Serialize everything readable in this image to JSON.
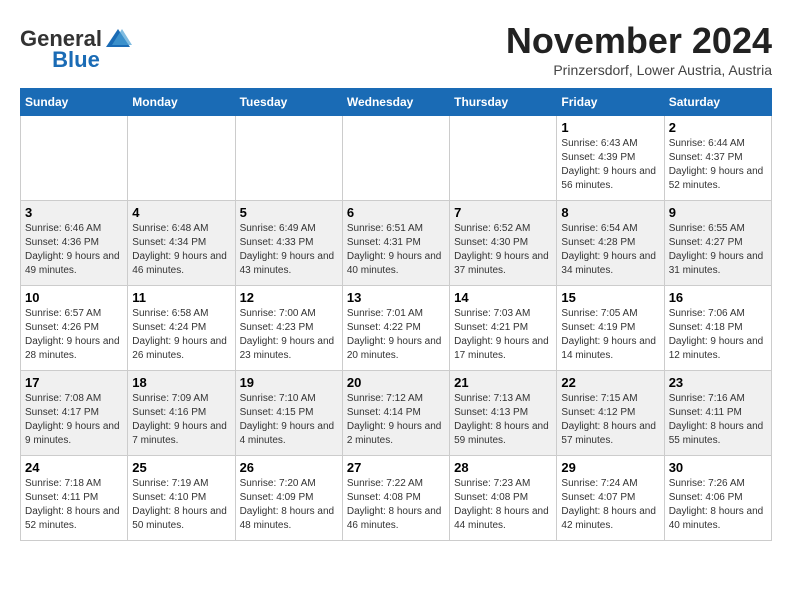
{
  "header": {
    "logo_general": "General",
    "logo_blue": "Blue",
    "month_title": "November 2024",
    "location": "Prinzersdorf, Lower Austria, Austria"
  },
  "days_of_week": [
    "Sunday",
    "Monday",
    "Tuesday",
    "Wednesday",
    "Thursday",
    "Friday",
    "Saturday"
  ],
  "weeks": [
    [
      {
        "day": "",
        "info": ""
      },
      {
        "day": "",
        "info": ""
      },
      {
        "day": "",
        "info": ""
      },
      {
        "day": "",
        "info": ""
      },
      {
        "day": "",
        "info": ""
      },
      {
        "day": "1",
        "info": "Sunrise: 6:43 AM\nSunset: 4:39 PM\nDaylight: 9 hours and 56 minutes."
      },
      {
        "day": "2",
        "info": "Sunrise: 6:44 AM\nSunset: 4:37 PM\nDaylight: 9 hours and 52 minutes."
      }
    ],
    [
      {
        "day": "3",
        "info": "Sunrise: 6:46 AM\nSunset: 4:36 PM\nDaylight: 9 hours and 49 minutes."
      },
      {
        "day": "4",
        "info": "Sunrise: 6:48 AM\nSunset: 4:34 PM\nDaylight: 9 hours and 46 minutes."
      },
      {
        "day": "5",
        "info": "Sunrise: 6:49 AM\nSunset: 4:33 PM\nDaylight: 9 hours and 43 minutes."
      },
      {
        "day": "6",
        "info": "Sunrise: 6:51 AM\nSunset: 4:31 PM\nDaylight: 9 hours and 40 minutes."
      },
      {
        "day": "7",
        "info": "Sunrise: 6:52 AM\nSunset: 4:30 PM\nDaylight: 9 hours and 37 minutes."
      },
      {
        "day": "8",
        "info": "Sunrise: 6:54 AM\nSunset: 4:28 PM\nDaylight: 9 hours and 34 minutes."
      },
      {
        "day": "9",
        "info": "Sunrise: 6:55 AM\nSunset: 4:27 PM\nDaylight: 9 hours and 31 minutes."
      }
    ],
    [
      {
        "day": "10",
        "info": "Sunrise: 6:57 AM\nSunset: 4:26 PM\nDaylight: 9 hours and 28 minutes."
      },
      {
        "day": "11",
        "info": "Sunrise: 6:58 AM\nSunset: 4:24 PM\nDaylight: 9 hours and 26 minutes."
      },
      {
        "day": "12",
        "info": "Sunrise: 7:00 AM\nSunset: 4:23 PM\nDaylight: 9 hours and 23 minutes."
      },
      {
        "day": "13",
        "info": "Sunrise: 7:01 AM\nSunset: 4:22 PM\nDaylight: 9 hours and 20 minutes."
      },
      {
        "day": "14",
        "info": "Sunrise: 7:03 AM\nSunset: 4:21 PM\nDaylight: 9 hours and 17 minutes."
      },
      {
        "day": "15",
        "info": "Sunrise: 7:05 AM\nSunset: 4:19 PM\nDaylight: 9 hours and 14 minutes."
      },
      {
        "day": "16",
        "info": "Sunrise: 7:06 AM\nSunset: 4:18 PM\nDaylight: 9 hours and 12 minutes."
      }
    ],
    [
      {
        "day": "17",
        "info": "Sunrise: 7:08 AM\nSunset: 4:17 PM\nDaylight: 9 hours and 9 minutes."
      },
      {
        "day": "18",
        "info": "Sunrise: 7:09 AM\nSunset: 4:16 PM\nDaylight: 9 hours and 7 minutes."
      },
      {
        "day": "19",
        "info": "Sunrise: 7:10 AM\nSunset: 4:15 PM\nDaylight: 9 hours and 4 minutes."
      },
      {
        "day": "20",
        "info": "Sunrise: 7:12 AM\nSunset: 4:14 PM\nDaylight: 9 hours and 2 minutes."
      },
      {
        "day": "21",
        "info": "Sunrise: 7:13 AM\nSunset: 4:13 PM\nDaylight: 8 hours and 59 minutes."
      },
      {
        "day": "22",
        "info": "Sunrise: 7:15 AM\nSunset: 4:12 PM\nDaylight: 8 hours and 57 minutes."
      },
      {
        "day": "23",
        "info": "Sunrise: 7:16 AM\nSunset: 4:11 PM\nDaylight: 8 hours and 55 minutes."
      }
    ],
    [
      {
        "day": "24",
        "info": "Sunrise: 7:18 AM\nSunset: 4:11 PM\nDaylight: 8 hours and 52 minutes."
      },
      {
        "day": "25",
        "info": "Sunrise: 7:19 AM\nSunset: 4:10 PM\nDaylight: 8 hours and 50 minutes."
      },
      {
        "day": "26",
        "info": "Sunrise: 7:20 AM\nSunset: 4:09 PM\nDaylight: 8 hours and 48 minutes."
      },
      {
        "day": "27",
        "info": "Sunrise: 7:22 AM\nSunset: 4:08 PM\nDaylight: 8 hours and 46 minutes."
      },
      {
        "day": "28",
        "info": "Sunrise: 7:23 AM\nSunset: 4:08 PM\nDaylight: 8 hours and 44 minutes."
      },
      {
        "day": "29",
        "info": "Sunrise: 7:24 AM\nSunset: 4:07 PM\nDaylight: 8 hours and 42 minutes."
      },
      {
        "day": "30",
        "info": "Sunrise: 7:26 AM\nSunset: 4:06 PM\nDaylight: 8 hours and 40 minutes."
      }
    ]
  ]
}
